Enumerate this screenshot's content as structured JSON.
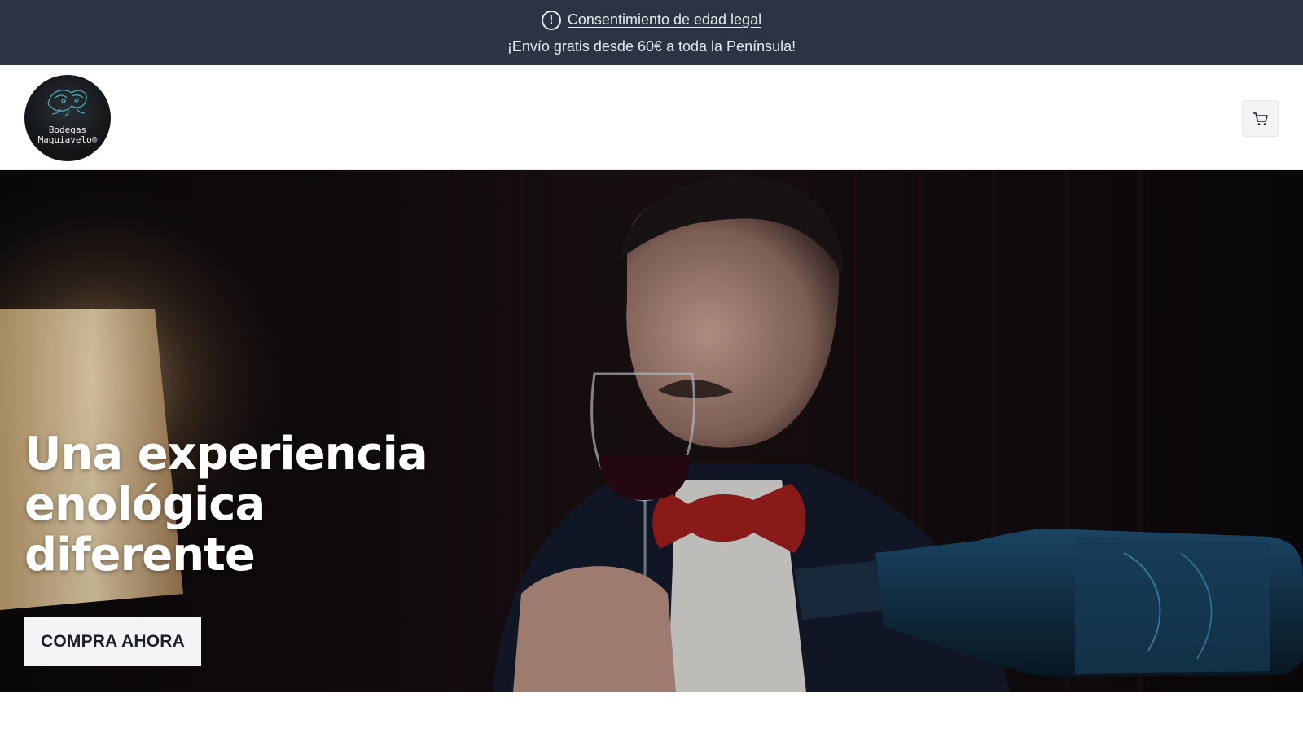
{
  "announcement": {
    "consent_link": "Consentimiento de edad legal",
    "shipping_text": "¡Envío gratis desde 60€ a toda la Península!",
    "icon": "alert-circle-icon",
    "background": "#2b3442"
  },
  "header": {
    "logo": {
      "line1": "Bodegas",
      "line2": "Maquiavelo®",
      "icon": "squid-logo-icon"
    },
    "cart_icon": "cart-icon"
  },
  "hero": {
    "title": "Una experiencia enológica diferente",
    "cta_label": "COMPRA AHORA"
  }
}
